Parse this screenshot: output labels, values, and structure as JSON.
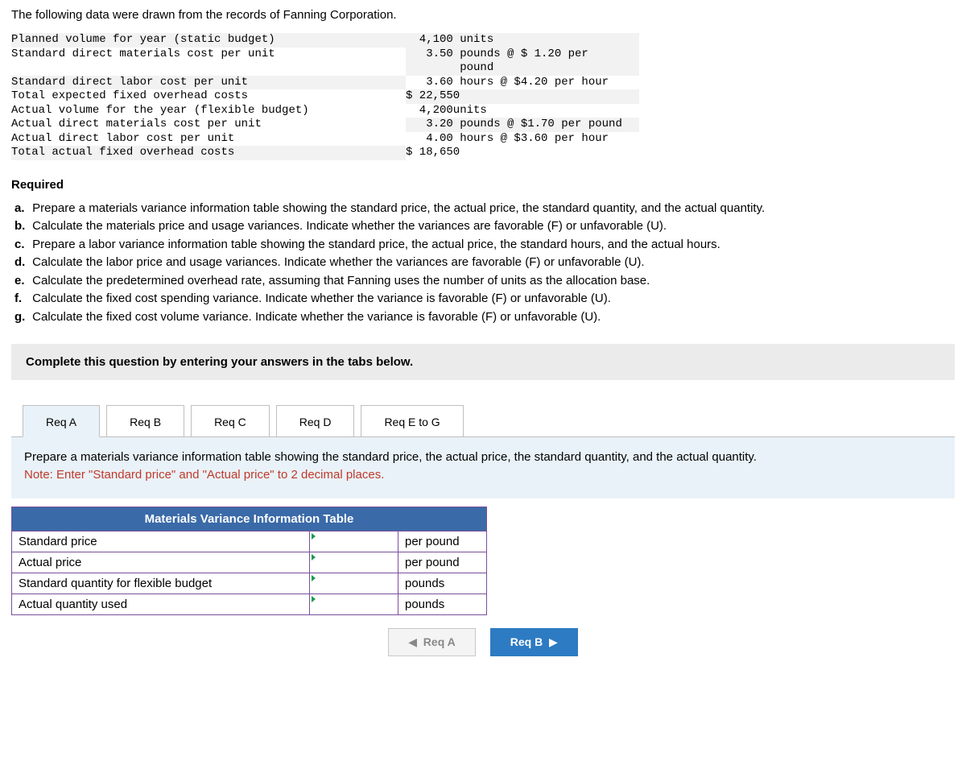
{
  "intro": "The following data were drawn from the records of Fanning Corporation.",
  "data_rows": [
    {
      "label": "Planned volume for year (static budget)",
      "value": "4,100 units",
      "shade_label": true,
      "shade_value": true
    },
    {
      "label": "Standard direct materials cost per unit",
      "value": "3.50 pounds @ $ 1.20 per pound",
      "shade_label": false,
      "shade_value": true
    },
    {
      "label": "Standard direct labor cost per unit",
      "value": "3.60 hours @ $4.20 per hour",
      "shade_label": true,
      "shade_value": false
    },
    {
      "label": "Total expected fixed overhead costs",
      "value": "$ 22,550",
      "shade_label": false,
      "shade_value": true
    },
    {
      "label": "Actual volume for the year (flexible budget)",
      "value": "4,200units",
      "shade_label": false,
      "shade_value": false
    },
    {
      "label": "Actual direct materials cost per unit",
      "value": "3.20 pounds @ $1.70 per pound",
      "shade_label": false,
      "shade_value": true
    },
    {
      "label": "Actual direct labor cost per unit",
      "value": "4.00 hours @ $3.60 per hour",
      "shade_label": false,
      "shade_value": false
    },
    {
      "label": "Total actual fixed overhead costs",
      "value": "$ 18,650",
      "shade_label": true,
      "shade_value": false
    }
  ],
  "required_heading": "Required",
  "requirements": [
    {
      "lbl": "a.",
      "text": "Prepare a materials variance information table showing the standard price, the actual price, the standard quantity, and the actual quantity."
    },
    {
      "lbl": "b.",
      "text": "Calculate the materials price and usage variances. Indicate whether the variances are favorable (F) or unfavorable (U)."
    },
    {
      "lbl": "c.",
      "text": "Prepare a labor variance information table showing the standard price, the actual price, the standard hours, and the actual hours."
    },
    {
      "lbl": "d.",
      "text": "Calculate the labor price and usage variances. Indicate whether the variances are favorable (F) or unfavorable (U)."
    },
    {
      "lbl": "e.",
      "text": "Calculate the predetermined overhead rate, assuming that Fanning uses the number of units as the allocation base."
    },
    {
      "lbl": "f.",
      "text": "Calculate the fixed cost spending variance. Indicate whether the variance is favorable (F) or unfavorable (U)."
    },
    {
      "lbl": "g.",
      "text": "Calculate the fixed cost volume variance. Indicate whether the variance is favorable (F) or unfavorable (U)."
    }
  ],
  "instruct": "Complete this question by entering your answers in the tabs below.",
  "tabs": {
    "a": "Req A",
    "b": "Req B",
    "c": "Req C",
    "d": "Req D",
    "e": "Req E to G"
  },
  "panel": {
    "prompt": "Prepare a materials variance information table showing the standard price, the actual price, the standard quantity, and the actual quantity.",
    "note": "Note: Enter \"Standard price\" and \"Actual price\" to 2 decimal places."
  },
  "var_table": {
    "heading": "Materials Variance Information Table",
    "rows": [
      {
        "label": "Standard price",
        "unit": "per pound"
      },
      {
        "label": "Actual price",
        "unit": "per pound"
      },
      {
        "label": "Standard quantity for flexible budget",
        "unit": "pounds"
      },
      {
        "label": "Actual quantity used",
        "unit": "pounds"
      }
    ]
  },
  "nav": {
    "prev": "Req A",
    "next": "Req B"
  }
}
